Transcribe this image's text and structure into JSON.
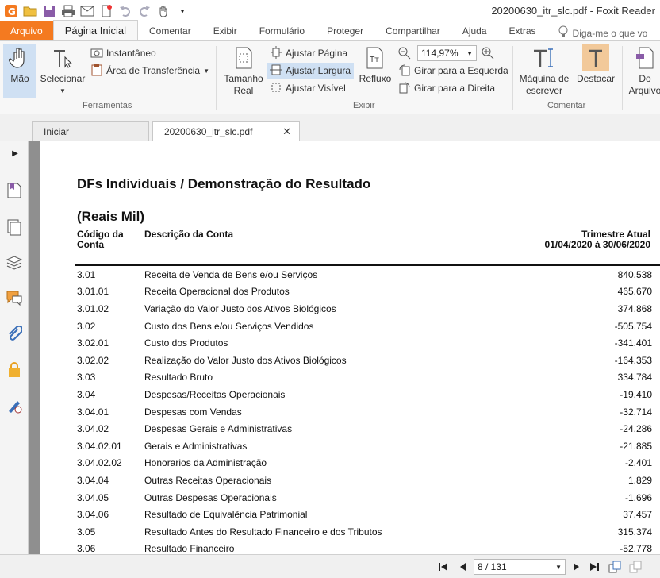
{
  "window": {
    "title": "20200630_itr_slc.pdf - Foxit Reader"
  },
  "ribbon_tabs": [
    "Arquivo",
    "Página Inicial",
    "Comentar",
    "Exibir",
    "Formulário",
    "Proteger",
    "Compartilhar",
    "Ajuda",
    "Extras"
  ],
  "tell_me": "Diga-me o que vo",
  "ribbon": {
    "mao": "Mão",
    "selecionar": "Selecionar",
    "instantaneo": "Instantâneo",
    "area_transferencia": "Área de Transferência",
    "group_ferramentas": "Ferramentas",
    "tamanho_real_1": "Tamanho",
    "tamanho_real_2": "Real",
    "ajustar_pagina": "Ajustar Página",
    "ajustar_largura": "Ajustar Largura",
    "ajustar_visivel": "Ajustar Visível",
    "refluxo": "Refluxo",
    "zoom": "114,97%",
    "girar_esquerda": "Girar para a Esquerda",
    "girar_direita": "Girar para a Direita",
    "group_exibir": "Exibir",
    "maquina_1": "Máquina de",
    "maquina_2": "escrever",
    "destacar": "Destacar",
    "group_comentar": "Comentar",
    "do_arquivo_1": "Do",
    "do_arquivo_2": "Arquivo"
  },
  "doc_tabs": {
    "start": "Iniciar",
    "file": "20200630_itr_slc.pdf"
  },
  "document": {
    "title": "DFs Individuais / Demonstração do Resultado",
    "subtitle": "(Reais Mil)",
    "col_code_1": "Código da",
    "col_code_2": "Conta",
    "col_desc": "Descrição da Conta",
    "col_value_1": "Trimestre Atual",
    "col_value_2": "01/04/2020 à 30/06/2020",
    "rows": [
      {
        "code": "3.01",
        "desc": "Receita de Venda de Bens e/ou Serviços",
        "value": "840.538"
      },
      {
        "code": "3.01.01",
        "desc": "Receita Operacional dos Produtos",
        "value": "465.670"
      },
      {
        "code": "3.01.02",
        "desc": "Variação do Valor Justo dos Ativos Biológicos",
        "value": "374.868"
      },
      {
        "code": "3.02",
        "desc": "Custo dos Bens e/ou Serviços Vendidos",
        "value": "-505.754"
      },
      {
        "code": "3.02.01",
        "desc": "Custo dos Produtos",
        "value": "-341.401"
      },
      {
        "code": "3.02.02",
        "desc": "Realização do Valor Justo dos Ativos Biológicos",
        "value": "-164.353"
      },
      {
        "code": "3.03",
        "desc": "Resultado Bruto",
        "value": "334.784"
      },
      {
        "code": "3.04",
        "desc": "Despesas/Receitas Operacionais",
        "value": "-19.410"
      },
      {
        "code": "3.04.01",
        "desc": "Despesas com Vendas",
        "value": "-32.714"
      },
      {
        "code": "3.04.02",
        "desc": "Despesas Gerais e Administrativas",
        "value": "-24.286"
      },
      {
        "code": "3.04.02.01",
        "desc": "Gerais e Administrativas",
        "value": "-21.885"
      },
      {
        "code": "3.04.02.02",
        "desc": "Honorarios da Administração",
        "value": "-2.401"
      },
      {
        "code": "3.04.04",
        "desc": "Outras Receitas Operacionais",
        "value": "1.829"
      },
      {
        "code": "3.04.05",
        "desc": "Outras Despesas Operacionais",
        "value": "-1.696"
      },
      {
        "code": "3.04.06",
        "desc": "Resultado de Equivalência Patrimonial",
        "value": "37.457"
      },
      {
        "code": "3.05",
        "desc": "Resultado Antes do Resultado Financeiro e dos Tributos",
        "value": "315.374"
      },
      {
        "code": "3.06",
        "desc": "Resultado Financeiro",
        "value": "-52.778"
      }
    ]
  },
  "nav": {
    "page_indicator": "8 / 131"
  },
  "colors": {
    "accent_orange": "#f47a20",
    "selection_blue": "#cfe0f3"
  }
}
